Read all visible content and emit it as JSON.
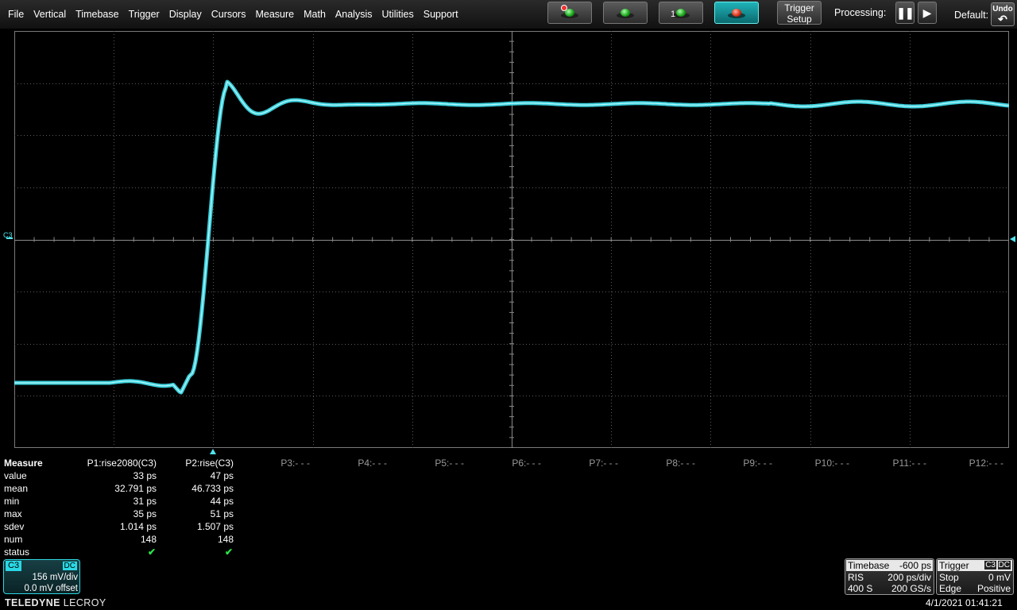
{
  "menu": [
    "File",
    "Vertical",
    "Timebase",
    "Trigger",
    "Display",
    "Cursors",
    "Measure",
    "Math",
    "Analysis",
    "Utilities",
    "Support"
  ],
  "toolbar": {
    "trigger_setup": [
      "Trigger",
      "Setup"
    ],
    "processing_label": "Processing:",
    "default_label": "Default:",
    "undo_label": "Undo",
    "one_label": "1",
    "led_icons": [
      "led-marker-icon",
      "led-green-icon",
      "led-one-icon",
      "led-red-icon"
    ]
  },
  "channel": {
    "marker": "C3",
    "color": "#4fe3ee"
  },
  "measure": {
    "title": "Measure",
    "row_labels": [
      "value",
      "mean",
      "min",
      "max",
      "sdev",
      "num",
      "status"
    ],
    "p1": {
      "name": "P1:rise2080(C3)",
      "values": [
        "33 ps",
        "32.791 ps",
        "31 ps",
        "35 ps",
        "1.014 ps",
        "148"
      ],
      "status": "✔"
    },
    "p2": {
      "name": "P2:rise(C3)",
      "values": [
        "47 ps",
        "46.733 ps",
        "44 ps",
        "51 ps",
        "1.507 ps",
        "148"
      ],
      "status": "✔"
    },
    "placeholders": [
      "P3:- - -",
      "P4:- - -",
      "P5:- - -",
      "P6:- - -",
      "P7:- - -",
      "P8:- - -",
      "P9:- - -",
      "P10:- - -",
      "P11:- - -",
      "P12:- - -"
    ]
  },
  "c3_descriptor": {
    "tag": "C3",
    "coupling": "DC",
    "vdiv": "156 mV/div",
    "offset": "0.0 mV offset"
  },
  "timebase": {
    "title": "Timebase",
    "delay": "-600 ps",
    "mode": "RIS",
    "tdiv": "200 ps/div",
    "points": "400 S",
    "rate": "200 GS/s"
  },
  "trigger": {
    "title": "Trigger",
    "channel": "C3",
    "coupling": "DC",
    "mode": "Stop",
    "level": "0 mV",
    "type": "Edge",
    "slope": "Positive"
  },
  "brand": {
    "left": "TELEDYNE",
    "right": "LECROY"
  },
  "datetime": "4/1/2021 01:41:21"
}
